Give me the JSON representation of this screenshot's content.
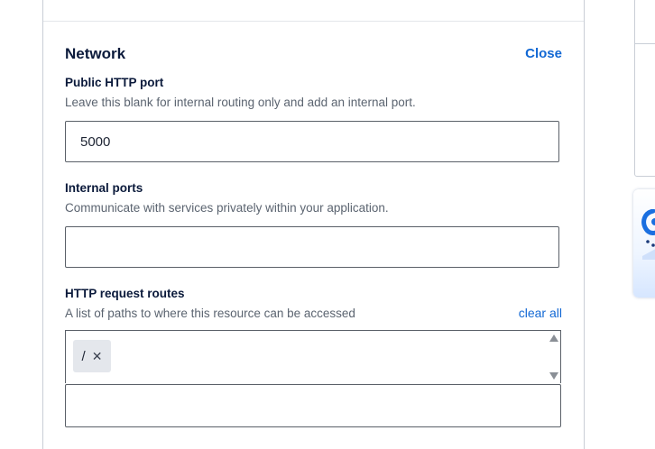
{
  "network": {
    "title": "Network",
    "close_label": "Close"
  },
  "public_http_port": {
    "label": "Public HTTP port",
    "help": "Leave this blank for internal routing only and add an internal port.",
    "value": "5000"
  },
  "internal_ports": {
    "label": "Internal ports",
    "help": "Communicate with services privately within your application.",
    "value": ""
  },
  "http_request_routes": {
    "label": "HTTP request routes",
    "help": "A list of paths to where this resource can be accessed",
    "clear_all_label": "clear all",
    "routes": [
      {
        "path": "/",
        "remove_icon": "close-icon"
      }
    ],
    "new_route_value": ""
  },
  "colors": {
    "link": "#1268d4",
    "heading": "#0b1a3b",
    "help_text": "#5b6470",
    "chip_bg": "#e4e7ec"
  }
}
